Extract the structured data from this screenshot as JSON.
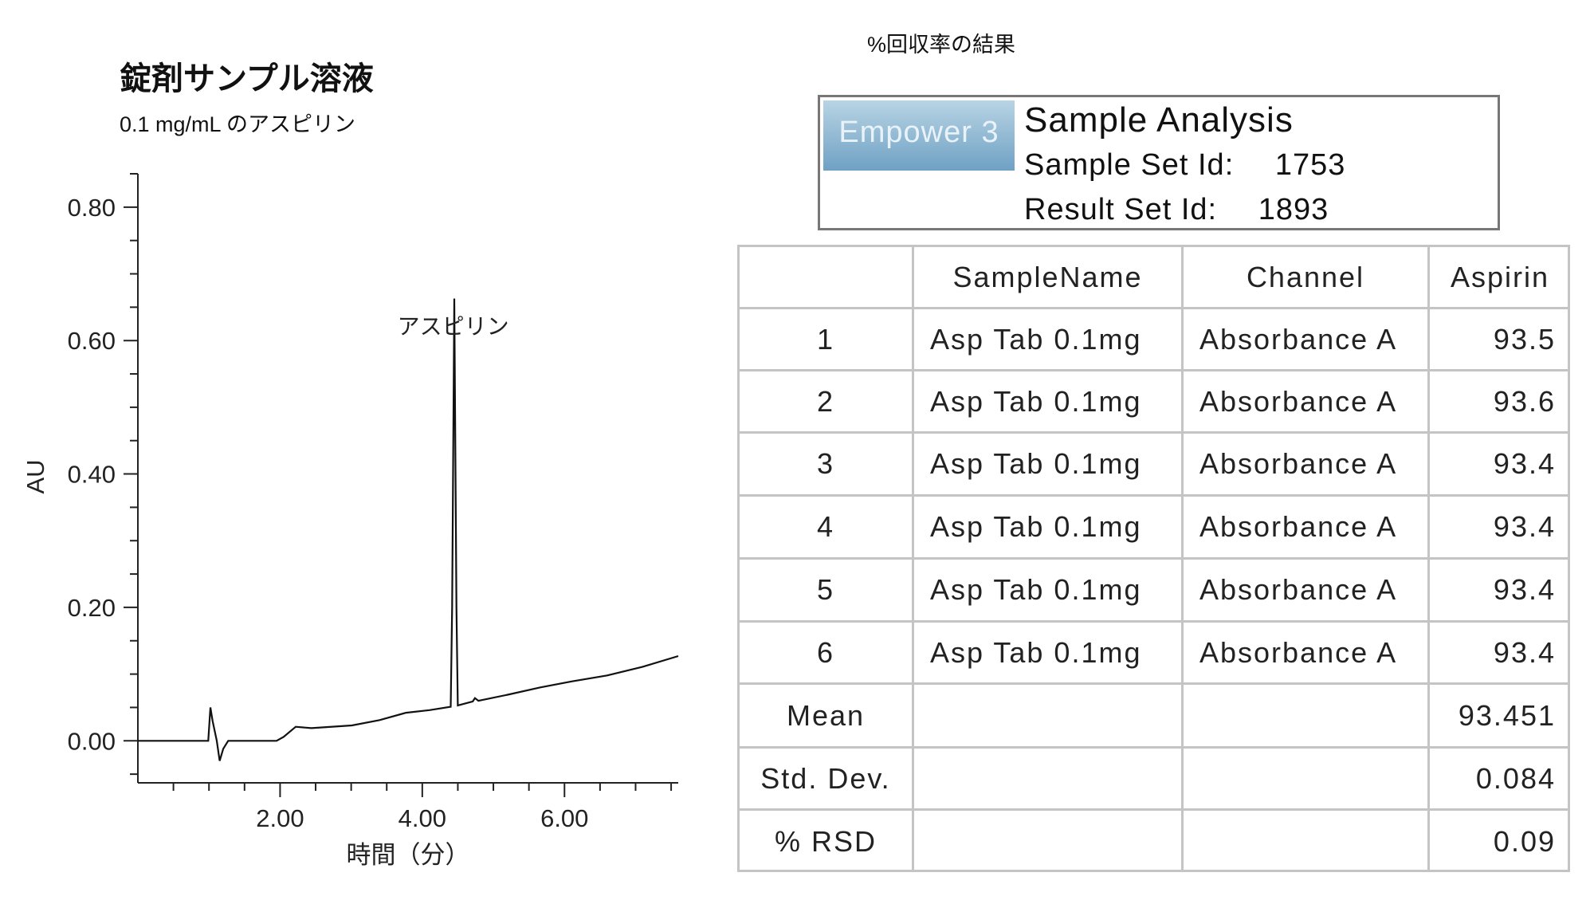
{
  "left_panel": {
    "title": "錠剤サンプル溶液",
    "subtitle": "0.1 mg/mL のアスピリン"
  },
  "right_panel": {
    "title": "%回収率の結果",
    "header": {
      "logo_text": "Empower 3",
      "heading": "Sample Analysis",
      "sample_set_label": "Sample Set Id:",
      "sample_set_id": "1753",
      "result_set_label": "Result Set Id:",
      "result_set_id": "1893"
    },
    "table": {
      "columns": [
        "",
        "SampleName",
        "Channel",
        "Aspirin"
      ],
      "rows": [
        [
          "1",
          "Asp Tab 0.1mg",
          "Absorbance A",
          "93.5"
        ],
        [
          "2",
          "Asp Tab 0.1mg",
          "Absorbance A",
          "93.6"
        ],
        [
          "3",
          "Asp Tab 0.1mg",
          "Absorbance A",
          "93.4"
        ],
        [
          "4",
          "Asp Tab 0.1mg",
          "Absorbance A",
          "93.4"
        ],
        [
          "5",
          "Asp Tab 0.1mg",
          "Absorbance A",
          "93.4"
        ],
        [
          "6",
          "Asp Tab 0.1mg",
          "Absorbance A",
          "93.4"
        ],
        [
          "Mean",
          "",
          "",
          "93.451"
        ],
        [
          "Std. Dev.",
          "",
          "",
          "0.084"
        ],
        [
          "% RSD",
          "",
          "",
          "0.09"
        ]
      ]
    }
  },
  "chart_data": {
    "type": "line",
    "title": "",
    "xlabel": "時間（分）",
    "ylabel": "AU",
    "xlim": [
      0,
      7.6
    ],
    "ylim": [
      -0.063,
      0.85
    ],
    "x_ticks": [
      2.0,
      4.0,
      6.0
    ],
    "x_tick_labels": [
      "2.00",
      "4.00",
      "6.00"
    ],
    "x_minor_step": 0.5,
    "y_ticks": [
      0.0,
      0.2,
      0.4,
      0.6,
      0.8
    ],
    "y_tick_labels": [
      "0.00",
      "0.20",
      "0.40",
      "0.60",
      "0.80"
    ],
    "y_minor_step": 0.05,
    "grid": false,
    "line_color": "#111111",
    "annotations": [
      {
        "text": "アスピリン",
        "x": 3.65,
        "y": 0.61
      }
    ],
    "series": [
      {
        "x": [
          0,
          0.99,
          1.02,
          1.05,
          1.11,
          1.15,
          1.2,
          1.27,
          1.95,
          2.05,
          2.22,
          2.44,
          3.01,
          3.4,
          3.77,
          4.1,
          4.4,
          4.42,
          4.45,
          4.48,
          4.5,
          4.71,
          4.74,
          4.79,
          5.2,
          5.66,
          6.1,
          6.6,
          7.1,
          7.6
        ],
        "y": [
          0,
          0,
          0.05,
          0.03,
          0,
          -0.03,
          -0.012,
          0,
          0,
          0.006,
          0.021,
          0.019,
          0.023,
          0.031,
          0.042,
          0.046,
          0.051,
          0.2,
          0.663,
          0.2,
          0.053,
          0.059,
          0.064,
          0.06,
          0.069,
          0.08,
          0.089,
          0.098,
          0.111,
          0.127
        ]
      }
    ]
  }
}
